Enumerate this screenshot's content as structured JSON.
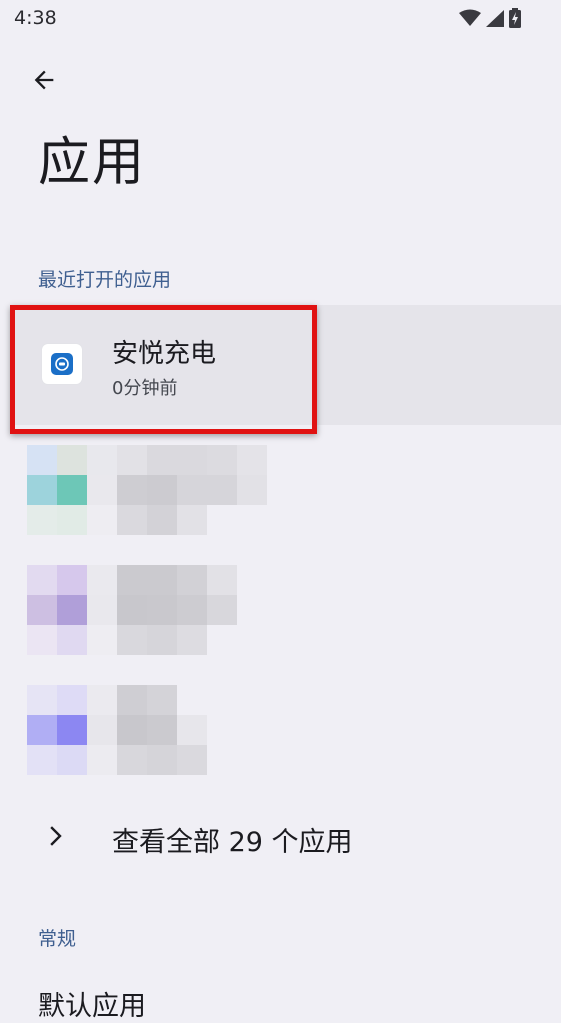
{
  "status_bar": {
    "time": "4:38",
    "icons": [
      "wifi-icon",
      "cell-signal-icon",
      "battery-charging-icon"
    ]
  },
  "header": {
    "back_icon": "arrow-back-icon",
    "title": "应用"
  },
  "recent_section": {
    "header": "最近打开的应用",
    "apps": [
      {
        "name": "安悦充电",
        "time": "0分钟前",
        "icon": "app-icon-anyue"
      }
    ],
    "obscured_items_count": 3
  },
  "see_all": {
    "label": "查看全部 29 个应用",
    "icon": "chevron-right-icon"
  },
  "general_section": {
    "header": "常规",
    "first_item": "默认应用"
  },
  "colors": {
    "background": "#f0eff5",
    "section_header": "#3f5f90",
    "highlight": "#e01212",
    "selected_row": "#e5e4ea"
  }
}
